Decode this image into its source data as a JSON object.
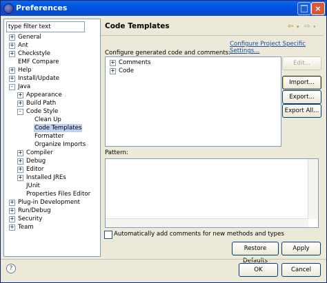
{
  "window": {
    "title": "Preferences",
    "close_glyph": "×"
  },
  "filter": {
    "value": "type filter text"
  },
  "tree": [
    {
      "label": "General",
      "expander": "+"
    },
    {
      "label": "Ant",
      "expander": "+"
    },
    {
      "label": "Checkstyle",
      "expander": "+"
    },
    {
      "label": "EMF Compare",
      "expander": ""
    },
    {
      "label": "Help",
      "expander": "+"
    },
    {
      "label": "Install/Update",
      "expander": "+"
    },
    {
      "label": "Java",
      "expander": "-"
    },
    {
      "label": "Appearance",
      "expander": "+"
    },
    {
      "label": "Build Path",
      "expander": "+"
    },
    {
      "label": "Code Style",
      "expander": "-"
    },
    {
      "label": "Clean Up",
      "expander": ""
    },
    {
      "label": "Code Templates",
      "expander": ""
    },
    {
      "label": "Formatter",
      "expander": ""
    },
    {
      "label": "Organize Imports",
      "expander": ""
    },
    {
      "label": "Compiler",
      "expander": "+"
    },
    {
      "label": "Debug",
      "expander": "+"
    },
    {
      "label": "Editor",
      "expander": "+"
    },
    {
      "label": "Installed JREs",
      "expander": "+"
    },
    {
      "label": "JUnit",
      "expander": ""
    },
    {
      "label": "Properties Files Editor",
      "expander": ""
    },
    {
      "label": "Plug-in Development",
      "expander": "+"
    },
    {
      "label": "Run/Debug",
      "expander": "+"
    },
    {
      "label": "Security",
      "expander": "+"
    },
    {
      "label": "Team",
      "expander": "+"
    }
  ],
  "page": {
    "title": "Code Templates",
    "link": "Configure Project Specific Settings...",
    "description": "Configure generated code and comments:",
    "templates": [
      {
        "label": "Comments",
        "expander": "+"
      },
      {
        "label": "Code",
        "expander": "+"
      }
    ],
    "pattern_label": "Pattern:",
    "checkbox_label": "Automatically add comments for new methods and types"
  },
  "buttons": {
    "edit": "Edit...",
    "import": "Import...",
    "export": "Export...",
    "export_all": "Export All...",
    "restore": "Restore Defaults",
    "apply": "Apply",
    "ok": "OK",
    "cancel": "Cancel"
  },
  "icons": {
    "back": "back-arrow-icon",
    "forward": "forward-arrow-icon",
    "help": "help-icon"
  }
}
